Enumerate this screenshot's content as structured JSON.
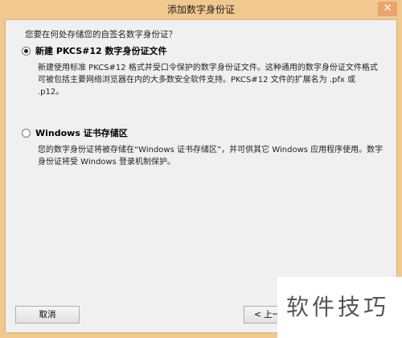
{
  "window": {
    "title": "添加数字身份证",
    "close_symbol": "✕"
  },
  "prompt": "您要在何处存储您的自签名数字身份证？",
  "options": [
    {
      "label": "新建 PKCS#12 数字身份证文件",
      "selected": true,
      "description": "新建使用标准 PKCS#12 格式并受口令保护的数字身份证文件。这种通用的数字身份证文件格式可被包括主要网络浏览器在内的大多数安全软件支持。PKCS#12 文件的扩展名为 .pfx 或 .p12。"
    },
    {
      "label": "Windows 证书存储区",
      "selected": false,
      "description": "您的数字身份证将被存储在“Windows 证书存储区”，并可供其它 Windows 应用程序使用。数字身份证将受 Windows 登录机制保护。"
    }
  ],
  "buttons": {
    "cancel": "取消",
    "back": "< 上一步"
  },
  "watermark": "软件技巧",
  "colors": {
    "title_bar": "#f0c890",
    "dialog_bg": "#f0f0f0",
    "close_button": "#e9a56a"
  }
}
